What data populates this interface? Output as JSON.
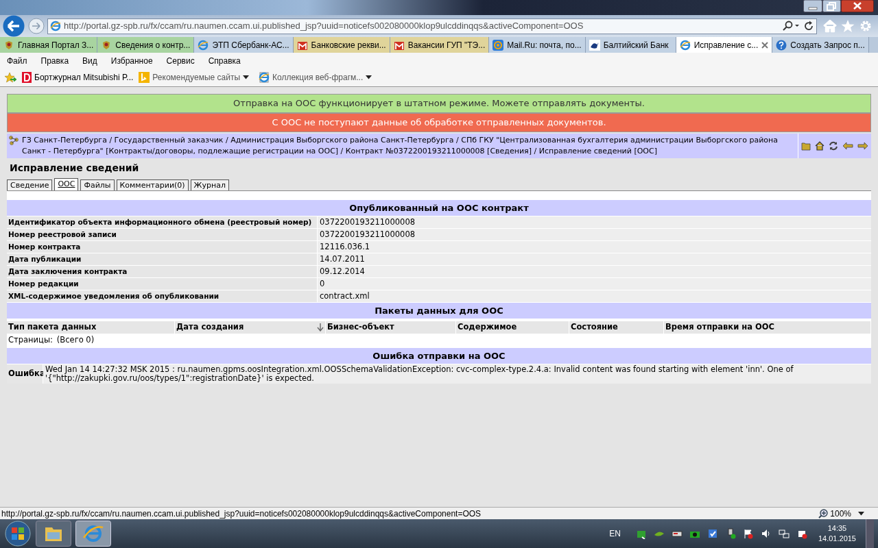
{
  "browser": {
    "address": "http://portal.gz-spb.ru/fx/ccam/ru.naumen.ccam.ui.published_jsp?uuid=noticefs002080000klop9ulcddinqqs&activeComponent=OOS",
    "tabs": [
      {
        "label": "Главная Портал З...",
        "kind": "emblem",
        "selected": false
      },
      {
        "label": "Сведения о контр...",
        "kind": "emblem",
        "selected": false
      },
      {
        "label": "ЭТП Сбербанк-АС...",
        "kind": "ie",
        "selected": false
      },
      {
        "label": "Банковские рекви...",
        "kind": "metro",
        "selected": false
      },
      {
        "label": "Вакансии ГУП \"ТЭ...",
        "kind": "metro",
        "selected": false
      },
      {
        "label": "Mail.Ru: почта, по...",
        "kind": "mail",
        "selected": false
      },
      {
        "label": "Балтийский Банк",
        "kind": "bank",
        "selected": false
      },
      {
        "label": "Исправление с...",
        "kind": "ie",
        "selected": true
      },
      {
        "label": "Создать Запрос п...",
        "kind": "help",
        "selected": false
      }
    ],
    "menu": [
      "Файл",
      "Правка",
      "Вид",
      "Избранное",
      "Сервис",
      "Справка"
    ],
    "favorites": [
      {
        "label": "Бортжурнал Mitsubishi P...",
        "kind": "d"
      },
      {
        "label": "Рекомендуемые сайты",
        "kind": "bing"
      },
      {
        "label": "Коллекция веб-фрагм...",
        "kind": "ie"
      }
    ],
    "status_url": "http://portal.gz-spb.ru/fx/ccam/ru.naumen.ccam.ui.published_jsp?uuid=noticefs002080000klop9ulcddinqqs&activeComponent=OOS",
    "zoom": "100%"
  },
  "page": {
    "banners": [
      {
        "text": "Отправка на ООС функционирует в штатном режиме. Можете отправлять документы.",
        "kind": "ok"
      },
      {
        "text": "С ООС не поступают данные об обработке отправленных документов.",
        "kind": "error"
      }
    ],
    "breadcrumb": "ГЗ Санкт-Петербурга / Государственный заказчик / Администрация Выборгского района Санкт-Петербурга / СПб ГКУ \"Централизованная бухгалтерия администрации Выборгского района Санкт - Петербурга\" [Контракты/договоры, подлежащие регистрации на ООС] / Контракт №0372200193211000008 [Сведения] / Исправление сведений [ООС]",
    "title": "Исправление сведений",
    "tabs": [
      {
        "label": "Сведение",
        "selected": false
      },
      {
        "label": "ООС",
        "selected": true
      },
      {
        "label": "Файлы",
        "selected": false
      },
      {
        "label": "Комментарии(0)",
        "selected": false
      },
      {
        "label": "Журнал",
        "selected": false
      }
    ],
    "contract": {
      "heading": "Опубликованный на ООС контракт",
      "fields": [
        {
          "label": "Идентификатор объекта информационного обмена (реестровый номер)",
          "value": "0372200193211000008"
        },
        {
          "label": "Номер реестровой записи",
          "value": "0372200193211000008"
        },
        {
          "label": "Номер контракта",
          "value": "12116.036.1"
        },
        {
          "label": "Дата публикации",
          "value": "14.07.2011"
        },
        {
          "label": "Дата заключения контракта",
          "value": "09.12.2014"
        },
        {
          "label": "Номер редакции",
          "value": "0"
        },
        {
          "label": "XML-содержимое уведомления об опубликовании",
          "value": "contract.xml"
        }
      ]
    },
    "packets": {
      "heading": "Пакеты данных для ООС",
      "columns": [
        {
          "label": "Тип пакета данных",
          "sorted": false
        },
        {
          "label": "Дата создания",
          "sorted": true
        },
        {
          "label": "Бизнес-объект",
          "sorted": false
        },
        {
          "label": "Содержимое",
          "sorted": false
        },
        {
          "label": "Состояние",
          "sorted": false
        },
        {
          "label": "Время отправки на ООС",
          "sorted": false
        }
      ],
      "pages_label": "Страницы:",
      "pages_total": "(Всего 0)"
    },
    "error": {
      "heading": "Ошибка отправки на ООС",
      "label": "Ошибка",
      "text": "Wed Jan 14 14:27:32 MSK 2015 : ru.naumen.gpms.oosIntegration.xml.OOSSchemaValidationException: cvc-complex-type.2.4.a: Invalid content was found starting with element 'inn'. One of '{\"http://zakupki.gov.ru/oos/types/1\":registrationDate}' is expected."
    }
  },
  "taskbar": {
    "language": "EN",
    "time": "14:35",
    "date": "14.01.2015"
  }
}
